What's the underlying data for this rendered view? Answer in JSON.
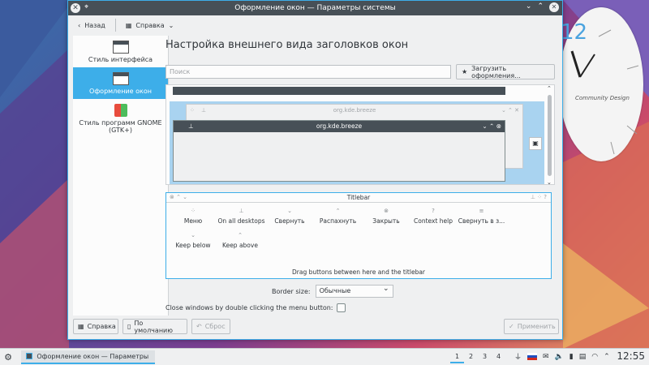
{
  "window": {
    "title": "Оформление окон — Параметры системы",
    "close_glyph": "✕",
    "pin_glyph": "⌖"
  },
  "toolbar": {
    "back_label": "Назад",
    "help_label": "Справка"
  },
  "sidebar": {
    "items": [
      {
        "label": "Стиль интерфейса",
        "icon": "widget-style-icon"
      },
      {
        "label": "Оформление окон",
        "icon": "window-decoration-icon",
        "active": true
      },
      {
        "label": "Стиль программ GNOME (GTK+)",
        "icon": "gtk-style-icon"
      }
    ]
  },
  "main": {
    "title": "Настройка внешнего вида заголовков окон",
    "search_placeholder": "Поиск",
    "load_button": "Загрузить оформления..."
  },
  "preview": {
    "back_title": "org.kde.breeze",
    "front_title": "org.kde.breeze"
  },
  "titlebar_editor": {
    "label": "Titlebar",
    "buttons": [
      {
        "label": "Меню",
        "icon": "menu-icon"
      },
      {
        "label": "On all desktops",
        "icon": "pin-icon"
      },
      {
        "label": "Свернуть",
        "icon": "minimize-icon"
      },
      {
        "label": "Распахнуть",
        "icon": "maximize-icon"
      },
      {
        "label": "Закрыть",
        "icon": "close-icon"
      },
      {
        "label": "Context help",
        "icon": "help-icon"
      },
      {
        "label": "Свернуть в з...",
        "icon": "shade-icon"
      },
      {
        "label": "Keep below",
        "icon": "keep-below-icon"
      },
      {
        "label": "Keep above",
        "icon": "keep-above-icon"
      }
    ],
    "hint": "Drag buttons between here and the titlebar"
  },
  "options": {
    "border_size_label": "Border size:",
    "border_size_value": "Обычные",
    "close_double_click_label": "Close windows by double clicking the menu button:"
  },
  "footer": {
    "help": "Справка",
    "defaults": "По умолчанию",
    "reset": "Сброс",
    "apply": "Применить"
  },
  "desktop": {
    "clock_number": "12",
    "clock_brand": "Community Design"
  },
  "taskbar": {
    "task_title": "Оформление окон — Параметры системы",
    "pager": [
      "1",
      "2",
      "3",
      "4"
    ],
    "time": "12:55"
  }
}
